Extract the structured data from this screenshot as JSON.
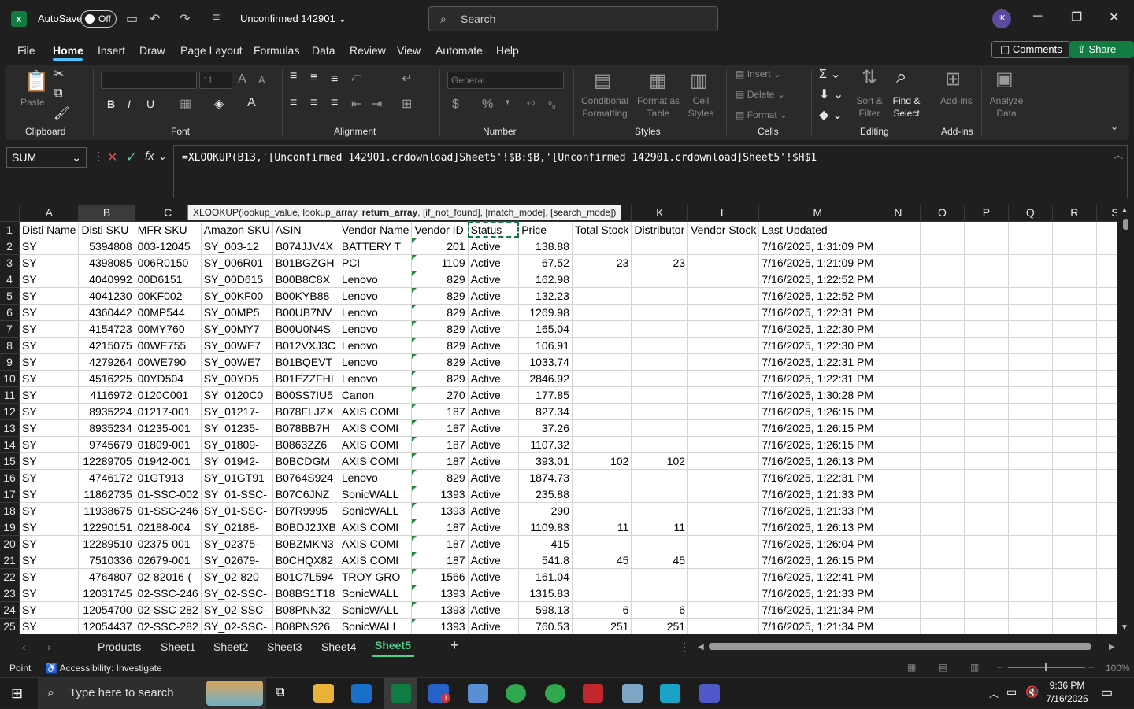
{
  "titlebar": {
    "app_icon": "excel-logo",
    "autosave_label": "AutoSave",
    "autosave_state": "Off",
    "doc_name": "Unconfirmed 142901",
    "search_placeholder": "Search",
    "avatar_initials": "IK",
    "minimize": "─",
    "restore": "❐",
    "close": "✕"
  },
  "menu": {
    "items": [
      "File",
      "Home",
      "Insert",
      "Draw",
      "Page Layout",
      "Formulas",
      "Data",
      "Review",
      "View",
      "Automate",
      "Help"
    ],
    "active": "Home",
    "comments_label": "Comments",
    "share_label": "Share"
  },
  "ribbon": {
    "clipboard": {
      "label": "Clipboard",
      "paste": "Paste"
    },
    "font": {
      "label": "Font",
      "font_name": "",
      "font_size": "11"
    },
    "alignment": {
      "label": "Alignment"
    },
    "number": {
      "label": "Number",
      "format": "General"
    },
    "styles": {
      "label": "Styles",
      "conditional": "Conditional Formatting",
      "format_as_table": "Format as Table",
      "cell_styles": "Cell Styles"
    },
    "cells": {
      "label": "Cells",
      "insert": "Insert",
      "delete": "Delete",
      "format": "Format"
    },
    "editing": {
      "label": "Editing",
      "sort_filter": "Sort & Filter",
      "find_select": "Find & Select"
    },
    "addins": {
      "label": "Add-ins",
      "addins": "Add-ins",
      "analyze": "Analyze Data"
    }
  },
  "formula_bar": {
    "name_box": "SUM",
    "formula": "=XLOOKUP(B13,'[Unconfirmed 142901.crdownload]Sheet5'!$B:$B,'[Unconfirmed 142901.crdownload]Sheet5'!$H$1",
    "tooltip_pre": "XLOOKUP(lookup_value, lookup_array, ",
    "tooltip_bold": "return_array",
    "tooltip_post": ", [if_not_found], [match_mode], [search_mode])"
  },
  "sheet": {
    "columns": [
      "A",
      "B",
      "C",
      "D",
      "E",
      "F",
      "G",
      "H",
      "I",
      "J",
      "K",
      "L",
      "M",
      "N",
      "O",
      "P",
      "Q",
      "R",
      "S"
    ],
    "selected_column": "B",
    "rows": [
      [
        "1",
        "Disti Name",
        "Disti SKU",
        "MFR SKU",
        "Amazon SKU",
        "ASIN",
        "Vendor Name",
        "Vendor ID",
        "Status",
        "Price",
        "Total Stock",
        "Distributor",
        "Vendor Stock",
        "Last Updated"
      ],
      [
        "2",
        "SY",
        "5394808",
        "003-12045",
        "SY_003-12",
        "B074JJV4X",
        "BATTERY T",
        "201",
        "Active",
        "138.88",
        "",
        "",
        "",
        "7/16/2025, 1:31:09 PM"
      ],
      [
        "3",
        "SY",
        "4398085",
        "006R0150",
        "SY_006R01",
        "B01BGZGH",
        "PCI",
        "1109",
        "Active",
        "67.52",
        "23",
        "23",
        "",
        "7/16/2025, 1:21:09 PM"
      ],
      [
        "4",
        "SY",
        "4040992",
        "00D6151",
        "SY_00D615",
        "B00B8C8X",
        "Lenovo",
        "829",
        "Active",
        "162.98",
        "",
        "",
        "",
        "7/16/2025, 1:22:52 PM"
      ],
      [
        "5",
        "SY",
        "4041230",
        "00KF002",
        "SY_00KF00",
        "B00KYB88",
        "Lenovo",
        "829",
        "Active",
        "132.23",
        "",
        "",
        "",
        "7/16/2025, 1:22:52 PM"
      ],
      [
        "6",
        "SY",
        "4360442",
        "00MP544",
        "SY_00MP5",
        "B00UB7NV",
        "Lenovo",
        "829",
        "Active",
        "1269.98",
        "",
        "",
        "",
        "7/16/2025, 1:22:31 PM"
      ],
      [
        "7",
        "SY",
        "4154723",
        "00MY760",
        "SY_00MY7",
        "B00U0N4S",
        "Lenovo",
        "829",
        "Active",
        "165.04",
        "",
        "",
        "",
        "7/16/2025, 1:22:30 PM"
      ],
      [
        "8",
        "SY",
        "4215075",
        "00WE755",
        "SY_00WE7",
        "B012VXJ3C",
        "Lenovo",
        "829",
        "Active",
        "106.91",
        "",
        "",
        "",
        "7/16/2025, 1:22:30 PM"
      ],
      [
        "9",
        "SY",
        "4279264",
        "00WE790",
        "SY_00WE7",
        "B01BQEVT",
        "Lenovo",
        "829",
        "Active",
        "1033.74",
        "",
        "",
        "",
        "7/16/2025, 1:22:31 PM"
      ],
      [
        "10",
        "SY",
        "4516225",
        "00YD504",
        "SY_00YD5",
        "B01EZZFHI",
        "Lenovo",
        "829",
        "Active",
        "2846.92",
        "",
        "",
        "",
        "7/16/2025, 1:22:31 PM"
      ],
      [
        "11",
        "SY",
        "4116972",
        "0120C001",
        "SY_0120C0",
        "B00SS7IU5",
        "Canon",
        "270",
        "Active",
        "177.85",
        "",
        "",
        "",
        "7/16/2025, 1:30:28 PM"
      ],
      [
        "12",
        "SY",
        "8935224",
        "01217-001",
        "SY_01217-",
        "B078FLJZX",
        "AXIS COMI",
        "187",
        "Active",
        "827.34",
        "",
        "",
        "",
        "7/16/2025, 1:26:15 PM"
      ],
      [
        "13",
        "SY",
        "8935234",
        "01235-001",
        "SY_01235-",
        "B078BB7H",
        "AXIS COMI",
        "187",
        "Active",
        "37.26",
        "",
        "",
        "",
        "7/16/2025, 1:26:15 PM"
      ],
      [
        "14",
        "SY",
        "9745679",
        "01809-001",
        "SY_01809-",
        "B0863ZZ6",
        "AXIS COMI",
        "187",
        "Active",
        "1107.32",
        "",
        "",
        "",
        "7/16/2025, 1:26:15 PM"
      ],
      [
        "15",
        "SY",
        "12289705",
        "01942-001",
        "SY_01942-",
        "B0BCDGM",
        "AXIS COMI",
        "187",
        "Active",
        "393.01",
        "102",
        "102",
        "",
        "7/16/2025, 1:26:13 PM"
      ],
      [
        "16",
        "SY",
        "4746172",
        "01GT913",
        "SY_01GT91",
        "B0764S924",
        "Lenovo",
        "829",
        "Active",
        "1874.73",
        "",
        "",
        "",
        "7/16/2025, 1:22:31 PM"
      ],
      [
        "17",
        "SY",
        "11862735",
        "01-SSC-002",
        "SY_01-SSC-",
        "B07C6JNZ",
        "SonicWALL",
        "1393",
        "Active",
        "235.88",
        "",
        "",
        "",
        "7/16/2025, 1:21:33 PM"
      ],
      [
        "18",
        "SY",
        "11938675",
        "01-SSC-246",
        "SY_01-SSC-",
        "B07R9995",
        "SonicWALL",
        "1393",
        "Active",
        "290",
        "",
        "",
        "",
        "7/16/2025, 1:21:33 PM"
      ],
      [
        "19",
        "SY",
        "12290151",
        "02188-004",
        "SY_02188-",
        "B0BDJ2JXB",
        "AXIS COMI",
        "187",
        "Active",
        "1109.83",
        "11",
        "11",
        "",
        "7/16/2025, 1:26:13 PM"
      ],
      [
        "20",
        "SY",
        "12289510",
        "02375-001",
        "SY_02375-",
        "B0BZMKN3",
        "AXIS COMI",
        "187",
        "Active",
        "415",
        "",
        "",
        "",
        "7/16/2025, 1:26:04 PM"
      ],
      [
        "21",
        "SY",
        "7510336",
        "02679-001",
        "SY_02679-",
        "B0CHQX82",
        "AXIS COMI",
        "187",
        "Active",
        "541.8",
        "45",
        "45",
        "",
        "7/16/2025, 1:26:15 PM"
      ],
      [
        "22",
        "SY",
        "4764807",
        "02-82016-(",
        "SY_02-820",
        "B01C7L594",
        "TROY GRO",
        "1566",
        "Active",
        "161.04",
        "",
        "",
        "",
        "7/16/2025, 1:22:41 PM"
      ],
      [
        "23",
        "SY",
        "12031745",
        "02-SSC-246",
        "SY_02-SSC-",
        "B08BS1T18",
        "SonicWALL",
        "1393",
        "Active",
        "1315.83",
        "",
        "",
        "",
        "7/16/2025, 1:21:33 PM"
      ],
      [
        "24",
        "SY",
        "12054700",
        "02-SSC-282",
        "SY_02-SSC-",
        "B08PNN32",
        "SonicWALL",
        "1393",
        "Active",
        "598.13",
        "6",
        "6",
        "",
        "7/16/2025, 1:21:34 PM"
      ],
      [
        "25",
        "SY",
        "12054437",
        "02-SSC-282",
        "SY_02-SSC-",
        "B08PNS26",
        "SonicWALL",
        "1393",
        "Active",
        "760.53",
        "251",
        "251",
        "",
        "7/16/2025, 1:21:34 PM"
      ]
    ]
  },
  "tabs": {
    "items": [
      "Products",
      "Sheet1",
      "Sheet2",
      "Sheet3",
      "Sheet4",
      "Sheet5"
    ],
    "active": "Sheet5",
    "add_label": "+"
  },
  "status": {
    "mode": "Point",
    "accessibility": "Accessibility: Investigate",
    "zoom": "100%"
  },
  "taskbar": {
    "search_placeholder": "Type here to search",
    "time": "9:36 PM",
    "date": "7/16/2025",
    "badge": "1"
  }
}
